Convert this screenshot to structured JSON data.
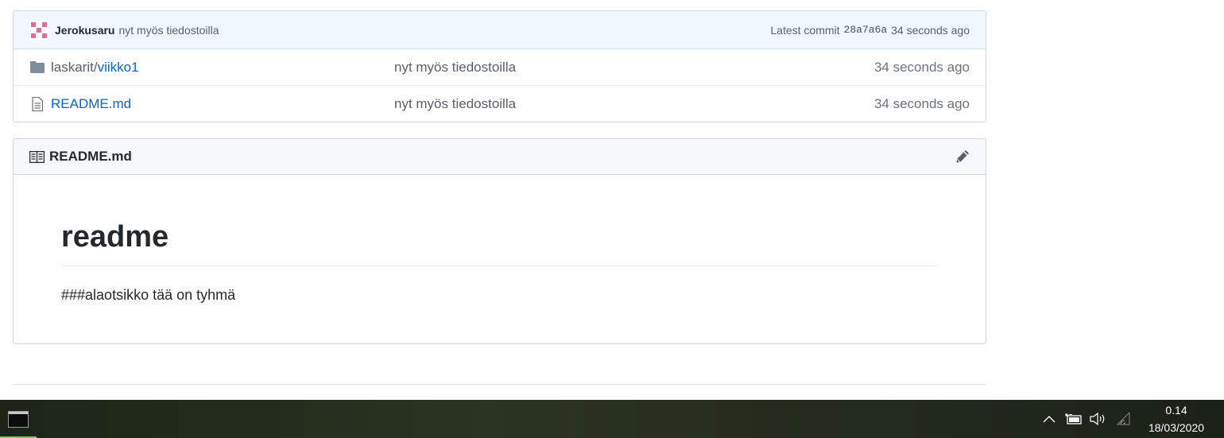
{
  "commit": {
    "author": "Jerokusaru",
    "message": "nyt myös tiedostoilla",
    "latest_label": "Latest commit",
    "sha": "28a7a6a",
    "age": "34 seconds ago"
  },
  "files": [
    {
      "name_prefix": "laskarit/",
      "name": "viikko1",
      "icon": "folder-icon",
      "message": "nyt myös tiedostoilla",
      "age": "34 seconds ago"
    },
    {
      "name_prefix": "",
      "name": "README.md",
      "icon": "file-icon",
      "message": "nyt myös tiedostoilla",
      "age": "34 seconds ago"
    }
  ],
  "readme": {
    "title": "README.md",
    "heading": "readme",
    "body": "###alaotsikko tää on tyhmä"
  },
  "taskbar": {
    "time": "0.14",
    "date": "18/03/2020"
  },
  "colors": {
    "link": "#0366d6",
    "commit_bar": "#f1f8ff",
    "avatar": "#e06a9a"
  }
}
